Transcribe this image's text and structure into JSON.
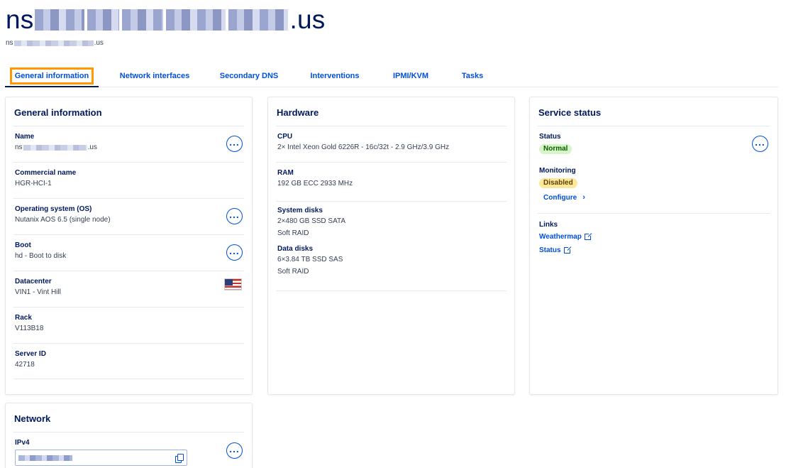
{
  "header": {
    "title_prefix": "ns",
    "title_suffix": ".us",
    "subtitle_prefix": "ns",
    "subtitle_suffix": ".us"
  },
  "tabs": [
    {
      "label": "General information",
      "active": true
    },
    {
      "label": "Network interfaces"
    },
    {
      "label": "Secondary DNS"
    },
    {
      "label": "Interventions"
    },
    {
      "label": "IPMI/KVM"
    },
    {
      "label": "Tasks"
    }
  ],
  "general": {
    "title": "General information",
    "name": {
      "label": "Name",
      "value_prefix": "ns",
      "value_suffix": ".us"
    },
    "commercial": {
      "label": "Commercial name",
      "value": "HGR-HCI-1"
    },
    "os": {
      "label": "Operating system (OS)",
      "value": "Nutanix AOS 6.5 (single node)"
    },
    "boot": {
      "label": "Boot",
      "value": "hd - Boot to disk"
    },
    "datacenter": {
      "label": "Datacenter",
      "value": "VIN1 - Vint Hill",
      "flag_icon": "us-flag-icon"
    },
    "rack": {
      "label": "Rack",
      "value": "V113B18"
    },
    "server_id": {
      "label": "Server ID",
      "value": "42718"
    }
  },
  "hardware": {
    "title": "Hardware",
    "cpu": {
      "label": "CPU",
      "value": "2× Intel Xeon Gold 6226R - 16c/32t - 2.9 GHz/3.9 GHz"
    },
    "ram": {
      "label": "RAM",
      "value": "192 GB ECC 2933 MHz"
    },
    "system_disks": {
      "label": "System disks",
      "line1": "2×480 GB SSD SATA",
      "line2": "Soft RAID"
    },
    "data_disks": {
      "label": "Data disks",
      "line1": "6×3.84 TB SSD SAS",
      "line2": "Soft RAID"
    }
  },
  "service": {
    "title": "Service status",
    "status": {
      "label": "Status",
      "badge": "Normal",
      "badge_color": "#d6f5c8"
    },
    "monitoring": {
      "label": "Monitoring",
      "badge": "Disabled",
      "badge_color": "#ffe79a",
      "configure_label": "Configure"
    },
    "links": {
      "label": "Links",
      "weathermap": "Weathermap",
      "status": "Status"
    }
  },
  "network": {
    "title": "Network",
    "ipv4": {
      "label": "IPv4"
    }
  },
  "colors": {
    "accent": "#0050d7",
    "navy": "#00185e",
    "highlight": "#ff9802"
  }
}
